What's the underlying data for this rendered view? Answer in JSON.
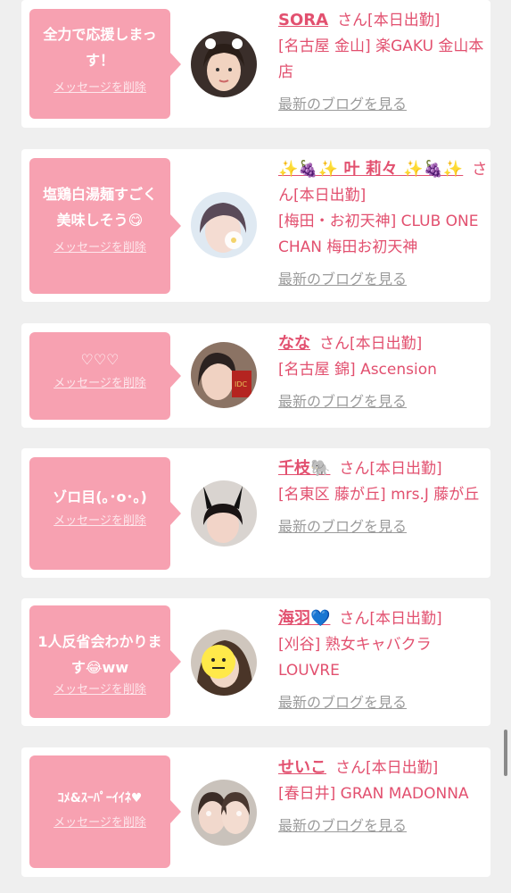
{
  "cards": [
    {
      "message": "全力で応援しまっす！",
      "delete_label": "メッセージを削除",
      "name": "SORA",
      "san": "さん[本日出勤]",
      "shop": "[名古屋 金山] 楽GAKU 金山本店",
      "blog": "最新のブログを見る",
      "avatar_icon": "person-photo"
    },
    {
      "message": "塩鶏白湯麺すごく美味しそう😋",
      "delete_label": "メッセージを削除",
      "name": "✨🍇✨ 叶 莉々 ✨🍇✨",
      "san": "さん[本日出勤]",
      "shop": "[梅田・お初天神] CLUB ONE CHAN 梅田お初天神",
      "blog": "最新のブログを見る",
      "avatar_icon": "person-photo"
    },
    {
      "message": "♡♡♡",
      "delete_label": "メッセージを削除",
      "name": "なな",
      "san": "さん[本日出勤]",
      "shop": "[名古屋 錦] Ascension",
      "blog": "最新のブログを見る",
      "avatar_icon": "person-photo"
    },
    {
      "message": "ゾロ目(｡･ο･｡)",
      "delete_label": "メッセージを削除",
      "name": "千枝🐘",
      "san": "さん[本日出勤]",
      "shop": "[名東区 藤が丘] mrs.J 藤が丘",
      "blog": "最新のブログを見る",
      "avatar_icon": "person-photo"
    },
    {
      "message": "1人反省会わかります😂ww",
      "delete_label": "メッセージを削除",
      "name": "海羽💙",
      "san": "さん[本日出勤]",
      "shop": "[刈谷] 熟女キャバクラ LOUVRE",
      "blog": "最新のブログを見る",
      "avatar_icon": "person-photo"
    },
    {
      "message": "ｺﾒ&ｽｰﾊﾟｰｲｲﾈ♥",
      "delete_label": "メッセージを削除",
      "name": "せいこ",
      "san": "さん[本日出勤]",
      "shop": "[春日井] GRAN MADONNA",
      "blog": "最新のブログを見る",
      "avatar_icon": "person-photo"
    }
  ],
  "colors": {
    "bubble": "#f7a1b1",
    "name": "#e2506f",
    "blog_link": "#9b9b9b",
    "background": "#efefef"
  }
}
